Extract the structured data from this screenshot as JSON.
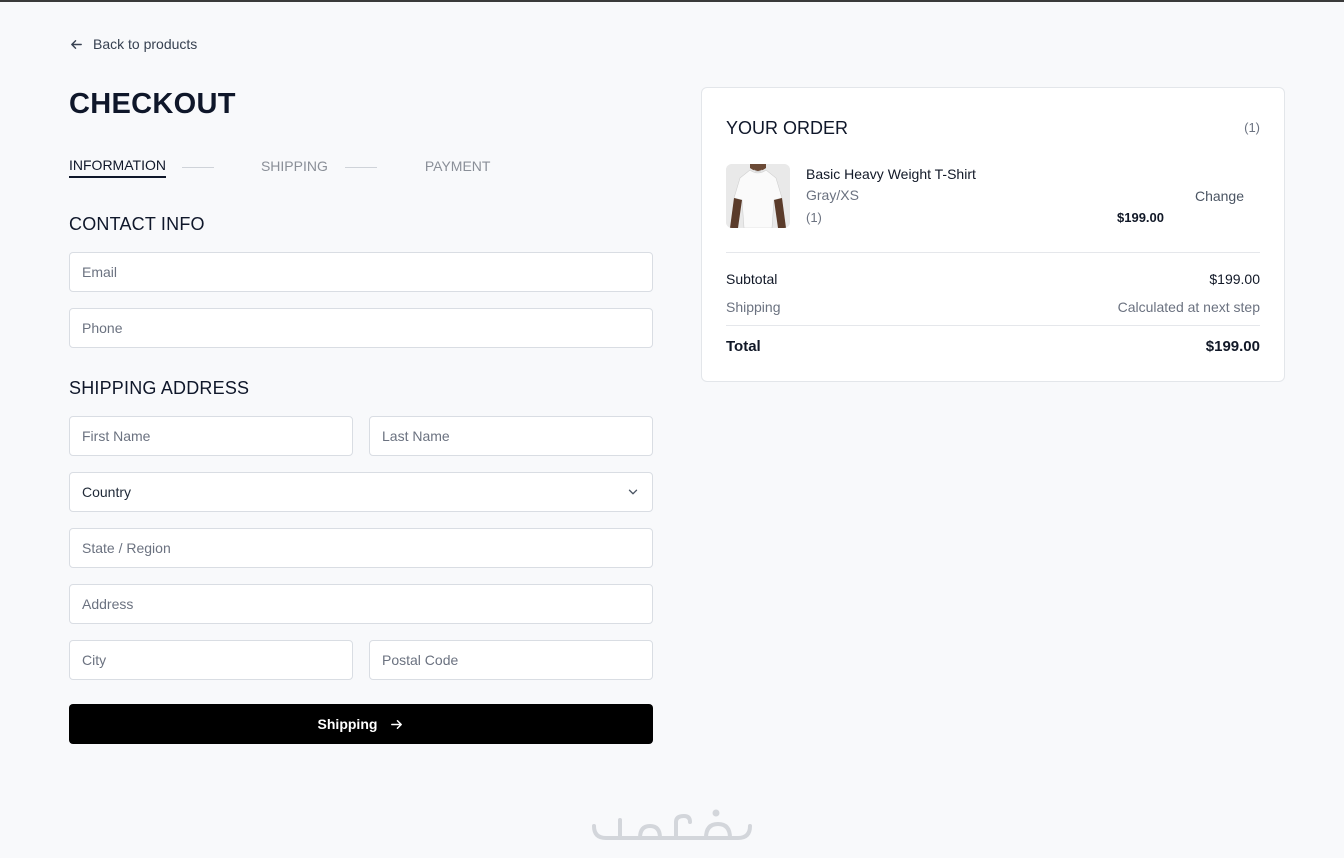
{
  "nav": {
    "back_label": "Back to products"
  },
  "page": {
    "title": "CHECKOUT"
  },
  "steps": [
    {
      "label": "INFORMATION",
      "active": true
    },
    {
      "label": "SHIPPING",
      "active": false
    },
    {
      "label": "PAYMENT",
      "active": false
    }
  ],
  "contact": {
    "title": "CONTACT INFO",
    "email_placeholder": "Email",
    "phone_placeholder": "Phone"
  },
  "shipping_address": {
    "title": "SHIPPING ADDRESS",
    "first_name_placeholder": "First Name",
    "last_name_placeholder": "Last Name",
    "country_value": "Country",
    "state_placeholder": "State / Region",
    "address_placeholder": "Address",
    "city_placeholder": "City",
    "postal_placeholder": "Postal Code"
  },
  "submit": {
    "label": "Shipping"
  },
  "order": {
    "title": "YOUR ORDER",
    "count": "(1)",
    "item": {
      "name": "Basic Heavy Weight T-Shirt",
      "variant": "Gray/XS",
      "quantity": "(1)",
      "price": "$199.00",
      "change_label": "Change"
    },
    "subtotal_label": "Subtotal",
    "subtotal_value": "$199.00",
    "shipping_label": "Shipping",
    "shipping_value": "Calculated at next step",
    "total_label": "Total",
    "total_value": "$199.00"
  },
  "colors": {
    "background": "#f8f9fb",
    "primary_button": "#000000",
    "text_primary": "#0f172a",
    "text_muted": "#6b7280"
  },
  "icons": {
    "back": "arrow-left-icon",
    "submit": "arrow-right-icon",
    "select": "chevron-down-icon"
  }
}
